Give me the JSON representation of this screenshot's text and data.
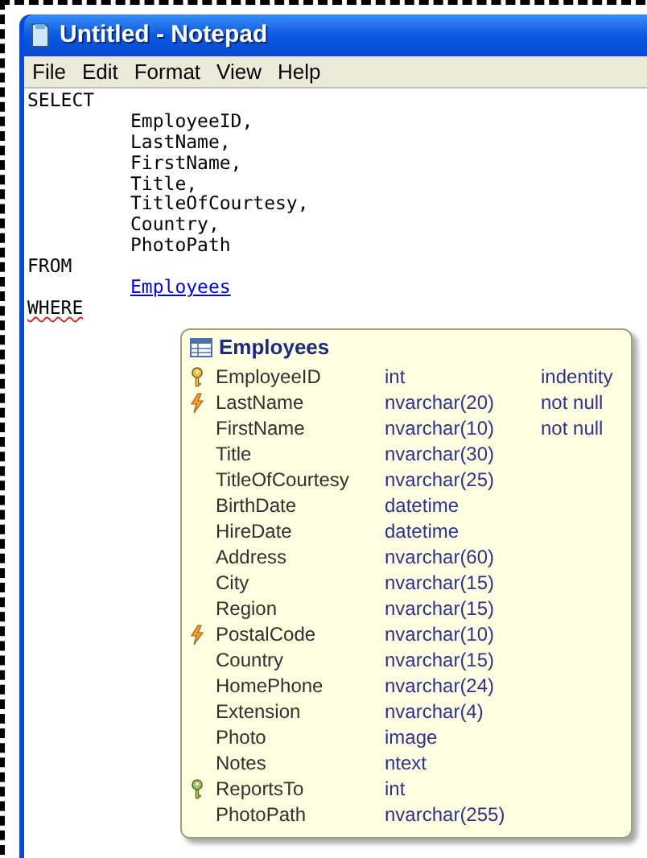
{
  "window": {
    "title": "Untitled - Notepad"
  },
  "menu": [
    "File",
    "Edit",
    "Format",
    "View",
    "Help"
  ],
  "editor": {
    "lines": [
      {
        "text": "SELECT",
        "kind": "keyword",
        "misspelled": false
      },
      {
        "text": "EmployeeID,",
        "kind": "column",
        "misspelled": false
      },
      {
        "text": "LastName,",
        "kind": "column",
        "misspelled": false
      },
      {
        "text": "FirstName,",
        "kind": "column",
        "misspelled": false
      },
      {
        "text": "Title,",
        "kind": "column",
        "misspelled": false
      },
      {
        "text": "TitleOfCourtesy,",
        "kind": "column",
        "misspelled": false
      },
      {
        "text": "Country,",
        "kind": "column",
        "misspelled": false
      },
      {
        "text": "PhotoPath",
        "kind": "column",
        "misspelled": false
      },
      {
        "text": "FROM",
        "kind": "keyword",
        "misspelled": false
      },
      {
        "text": "Employees",
        "kind": "link",
        "misspelled": false
      },
      {
        "text": "WHERE",
        "kind": "keyword",
        "misspelled": true
      }
    ]
  },
  "tooltip": {
    "title": "Employees",
    "columns": [
      {
        "name": "EmployeeID",
        "type": "int",
        "constraint": "indentity",
        "kind": "primary"
      },
      {
        "name": "LastName",
        "type": "nvarchar(20)",
        "constraint": "not null",
        "kind": "index"
      },
      {
        "name": "FirstName",
        "type": "nvarchar(10)",
        "constraint": "not null",
        "kind": "plain"
      },
      {
        "name": "Title",
        "type": "nvarchar(30)",
        "kind": "plain"
      },
      {
        "name": "TitleOfCourtesy",
        "type": "nvarchar(25)",
        "kind": "plain"
      },
      {
        "name": "BirthDate",
        "type": "datetime",
        "kind": "plain"
      },
      {
        "name": "HireDate",
        "type": "datetime",
        "kind": "plain"
      },
      {
        "name": "Address",
        "type": "nvarchar(60)",
        "kind": "plain"
      },
      {
        "name": "City",
        "type": "nvarchar(15)",
        "kind": "plain"
      },
      {
        "name": "Region",
        "type": "nvarchar(15)",
        "kind": "plain"
      },
      {
        "name": "PostalCode",
        "type": "nvarchar(10)",
        "kind": "index"
      },
      {
        "name": "Country",
        "type": "nvarchar(15)",
        "kind": "plain"
      },
      {
        "name": "HomePhone",
        "type": "nvarchar(24)",
        "kind": "plain"
      },
      {
        "name": "Extension",
        "type": "nvarchar(4)",
        "kind": "plain"
      },
      {
        "name": "Photo",
        "type": "image",
        "kind": "plain"
      },
      {
        "name": "Notes",
        "type": "ntext",
        "kind": "plain"
      },
      {
        "name": "ReportsTo",
        "type": "int",
        "kind": "foreign"
      },
      {
        "name": "PhotoPath",
        "type": "nvarchar(255)",
        "kind": "plain"
      }
    ]
  }
}
